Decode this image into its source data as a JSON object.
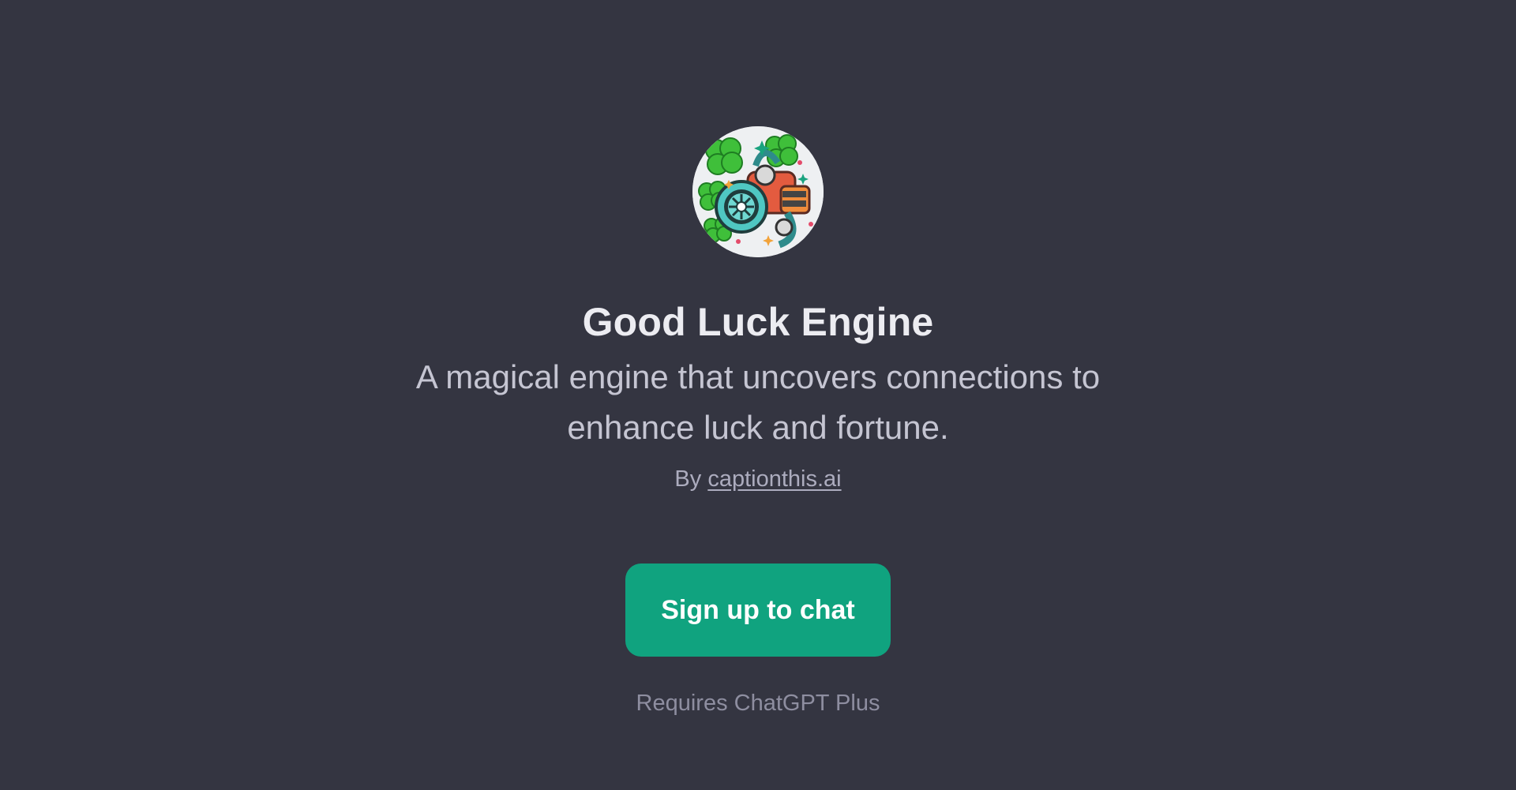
{
  "gpt": {
    "avatar_icon": "lucky-engine-clover-icon",
    "title": "Good Luck Engine",
    "description": "A magical engine that uncovers connections to enhance luck and fortune.",
    "by_prefix": "By",
    "author": "captionthis.ai"
  },
  "actions": {
    "signup_label": "Sign up to chat",
    "requirement_note": "Requires ChatGPT Plus"
  },
  "colors": {
    "background": "#343541",
    "accent": "#10a37f",
    "title": "#ececf1",
    "description": "#c5c5d2",
    "muted": "#8e8ea0"
  }
}
